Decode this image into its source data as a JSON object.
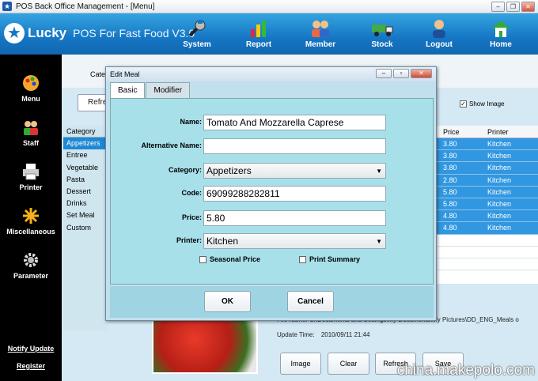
{
  "window": {
    "title": "POS Back Office Management - [Menu]"
  },
  "header": {
    "brand": "Lucky",
    "subtitle": "POS For Fast Food V3.0",
    "nav": [
      {
        "label": "System",
        "icon": "system-wrench-icon"
      },
      {
        "label": "Report",
        "icon": "report-chart-icon"
      },
      {
        "label": "Member",
        "icon": "member-people-icon"
      },
      {
        "label": "Stock",
        "icon": "stock-truck-icon"
      }
    ],
    "nav_right": [
      {
        "label": "Logout",
        "icon": "logout-user-icon"
      },
      {
        "label": "Home",
        "icon": "home-icon"
      }
    ]
  },
  "sidebar": {
    "items": [
      {
        "label": "Menu",
        "icon": "menu-palette-icon"
      },
      {
        "label": "Staff",
        "icon": "staff-people-icon"
      },
      {
        "label": "Printer",
        "icon": "printer-icon"
      },
      {
        "label": "Miscellaneous",
        "icon": "miscellaneous-icon"
      },
      {
        "label": "Parameter",
        "icon": "parameter-gear-icon"
      }
    ],
    "links": [
      "Notify Update",
      "Register"
    ]
  },
  "main": {
    "category_label_partial": "Cate",
    "refresh_label": "Refre",
    "show_image_label": "Show Image",
    "categories_header": "Category",
    "categories": [
      "Appetizers",
      "Entree",
      "Vegetable",
      "Pasta",
      "Dessert",
      "Drinks",
      "Set Meal",
      "Custom"
    ],
    "grid_headers": [
      "Price",
      "Printer"
    ],
    "grid_rows": [
      [
        "3.80",
        "Kitchen"
      ],
      [
        "3.80",
        "Kitchen"
      ],
      [
        "3.80",
        "Kitchen"
      ],
      [
        "2.80",
        "Kitchen"
      ],
      [
        "5.80",
        "Kitchen"
      ],
      [
        "5.80",
        "Kitchen"
      ],
      [
        "4.80",
        "Kitchen"
      ],
      [
        "4.80",
        "Kitchen"
      ]
    ],
    "file_name_text": "File Name:  C:\\Documents and Settings\\My Documents\\My Pictures\\DD_ENG_Meals o",
    "update_time_label": "Update Time:",
    "update_time_value": "2010/09/11 21:44",
    "buttons": [
      "Image",
      "Clear",
      "Refresh",
      "Save"
    ]
  },
  "dialog": {
    "title": "Edit Meal",
    "tabs": [
      "Basic",
      "Modifier"
    ],
    "fields": {
      "name_label": "Name:",
      "name_value": "Tomato And Mozzarella Caprese",
      "alt_name_label": "Alternative Name:",
      "alt_name_value": "",
      "category_label": "Category:",
      "category_value": "Appetizers",
      "code_label": "Code:",
      "code_value": "69099288282811",
      "price_label": "Price:",
      "price_value": "5.80",
      "printer_label": "Printer:",
      "printer_value": "Kitchen"
    },
    "checkboxes": {
      "seasonal": "Seasonal Price",
      "print_summary": "Print Summary"
    },
    "ok_label": "OK",
    "cancel_label": "Cancel"
  },
  "watermark": "china.makepolo.com"
}
